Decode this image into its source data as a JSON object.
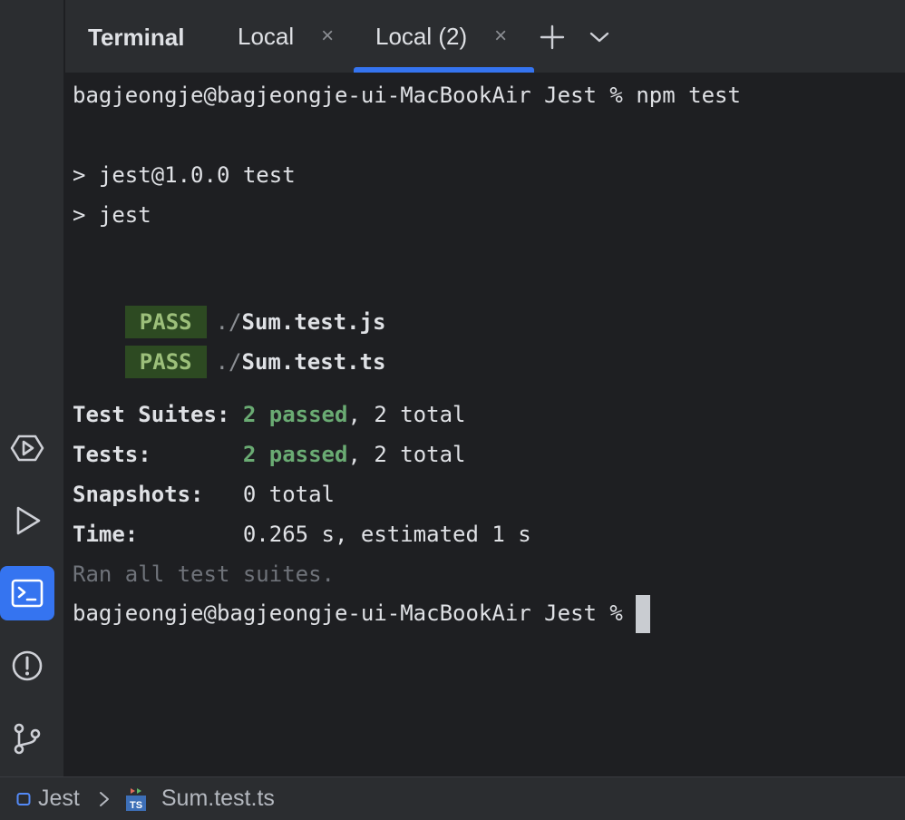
{
  "tabbar": {
    "title": "Terminal",
    "tabs": [
      {
        "label": "Local",
        "close": "×"
      },
      {
        "label": "Local (2)",
        "close": "×"
      }
    ]
  },
  "terminal": {
    "prompt_line": "bagjeongje@bagjeongje-ui-MacBookAir Jest % npm test",
    "script_line_1": "> jest@1.0.0 test",
    "script_line_2": "> jest",
    "results": [
      {
        "badge": "PASS",
        "path_prefix": "./",
        "file": "Sum.test.js"
      },
      {
        "badge": "PASS",
        "path_prefix": "./",
        "file": "Sum.test.ts"
      }
    ],
    "summary": {
      "suites_label": "Test Suites:",
      "suites_passed": "2 passed",
      "suites_total": ", 2 total",
      "tests_label": "Tests:",
      "tests_passed": "2 passed",
      "tests_total": ", 2 total",
      "snapshots_label": "Snapshots:",
      "snapshots_value": "0 total",
      "time_label": "Time:",
      "time_value": "0.265 s, estimated 1 s"
    },
    "ran_all": "Ran all test suites.",
    "final_prompt": "bagjeongje@bagjeongje-ui-MacBookAir Jest % "
  },
  "statusbar": {
    "project": "Jest",
    "separator": ">",
    "file": "Sum.test.ts",
    "file_icon_text": "TS"
  },
  "colors": {
    "accent": "#3574f0",
    "pass_badge_bg": "#2d4a22",
    "pass_text": "#6aab73"
  },
  "icons": [
    "services-icon",
    "run-icon",
    "terminal-icon",
    "problems-icon",
    "git-icon",
    "plus-icon",
    "chevron-down-icon",
    "close-icon",
    "module-icon",
    "typescript-file-icon"
  ]
}
